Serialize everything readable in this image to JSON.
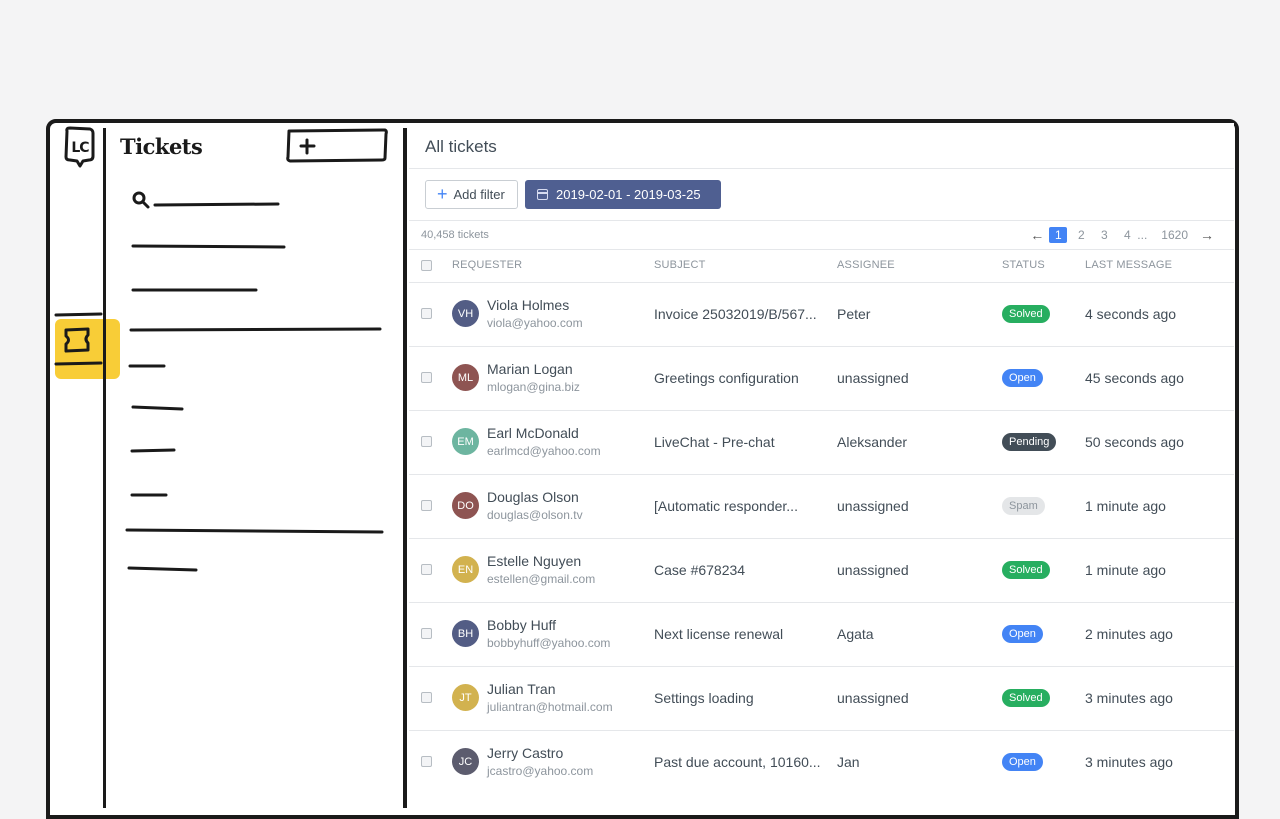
{
  "sidebar": {
    "logo": "LC",
    "title": "Tickets",
    "add_label": "+"
  },
  "main": {
    "title": "All tickets",
    "add_filter_label": "Add filter",
    "date_range": "2019-02-01 - 2019-03-25",
    "ticket_count": "40,458 tickets",
    "pagination": {
      "prev": "←",
      "pages": [
        "1",
        "2",
        "3",
        "4"
      ],
      "ellipsis": "...",
      "last": "1620",
      "next": "→",
      "current": "1"
    },
    "columns": [
      "REQUESTER",
      "SUBJECT",
      "ASSIGNEE",
      "STATUS",
      "LAST MESSAGE"
    ]
  },
  "colors": {
    "accent": "#4384f5",
    "date_chip": "#4f5f91",
    "rail_highlight": "#f8cd37",
    "status_solved": "#27ae60",
    "status_open": "#4384f5",
    "status_pending": "#424d57",
    "status_spam": "#e4e6e8"
  },
  "tickets": [
    {
      "initials": "VH",
      "avatar_color": "#535d85",
      "name": "Viola Holmes",
      "email": "viola@yahoo.com",
      "subject": "Invoice 25032019/B/567...",
      "assignee": "Peter",
      "status": "Solved",
      "status_type": "solved",
      "last_message": "4 seconds ago"
    },
    {
      "initials": "ML",
      "avatar_color": "#8e5452",
      "name": "Marian Logan",
      "email": "mlogan@gina.biz",
      "subject": "Greetings configuration",
      "assignee": "unassigned",
      "status": "Open",
      "status_type": "open",
      "last_message": "45 seconds ago"
    },
    {
      "initials": "EM",
      "avatar_color": "#6db5a0",
      "name": "Earl McDonald",
      "email": "earlmcd@yahoo.com",
      "subject": "LiveChat - Pre-chat",
      "assignee": "Aleksander",
      "status": "Pending",
      "status_type": "pending",
      "last_message": "50 seconds ago"
    },
    {
      "initials": "DO",
      "avatar_color": "#8e5452",
      "name": "Douglas Olson",
      "email": "douglas@olson.tv",
      "subject": "[Automatic responder...",
      "assignee": "unassigned",
      "status": "Spam",
      "status_type": "spam",
      "last_message": "1 minute ago"
    },
    {
      "initials": "EN",
      "avatar_color": "#d2b24f",
      "name": "Estelle Nguyen",
      "email": "estellen@gmail.com",
      "subject": "Case #678234",
      "assignee": "unassigned",
      "status": "Solved",
      "status_type": "solved",
      "last_message": "1 minute ago"
    },
    {
      "initials": "BH",
      "avatar_color": "#535d85",
      "name": "Bobby Huff",
      "email": "bobbyhuff@yahoo.com",
      "subject": "Next license renewal",
      "assignee": "Agata",
      "status": "Open",
      "status_type": "open",
      "last_message": "2 minutes ago"
    },
    {
      "initials": "JT",
      "avatar_color": "#d2b24f",
      "name": "Julian Tran",
      "email": "juliantran@hotmail.com",
      "subject": "Settings loading",
      "assignee": "unassigned",
      "status": "Solved",
      "status_type": "solved",
      "last_message": "3 minutes ago"
    },
    {
      "initials": "JC",
      "avatar_color": "#5c5c6e",
      "name": "Jerry Castro",
      "email": "jcastro@yahoo.com",
      "subject": "Past due account, 10160...",
      "assignee": "Jan",
      "status": "Open",
      "status_type": "open",
      "last_message": "3 minutes ago"
    }
  ]
}
